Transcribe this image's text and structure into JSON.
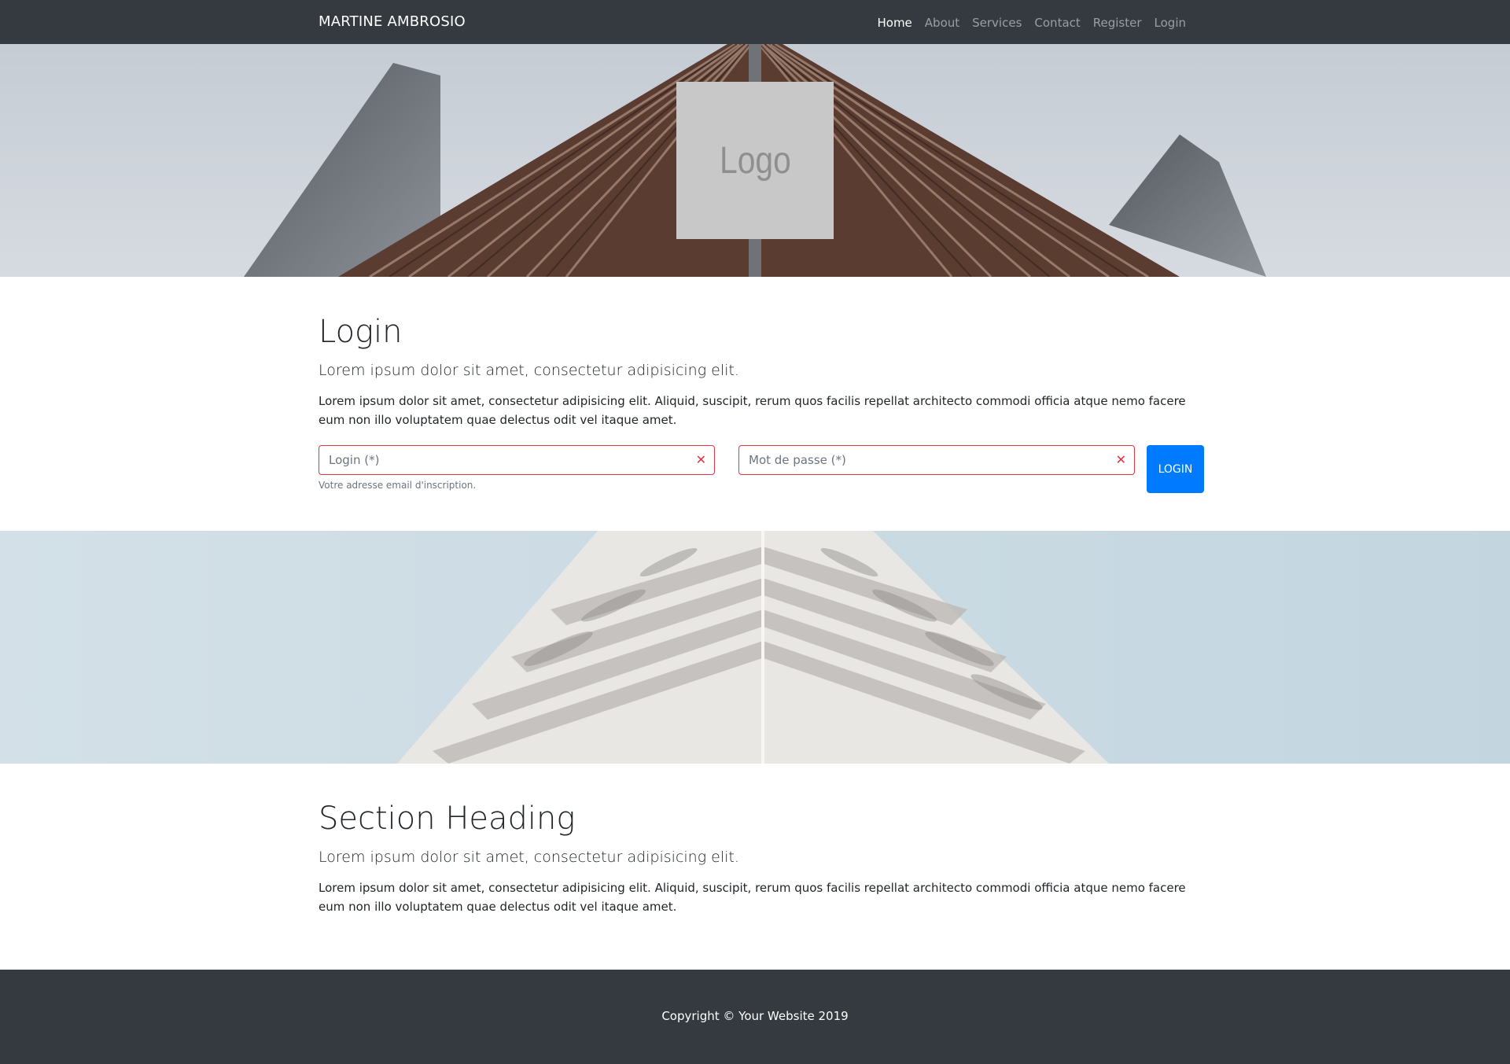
{
  "nav": {
    "brand": "MARTINE AMBROSIO",
    "links": [
      "Home",
      "About",
      "Services",
      "Contact",
      "Register",
      "Login"
    ]
  },
  "hero": {
    "logo_text": "Logo"
  },
  "login_section": {
    "title": "Login",
    "lead": "Lorem ipsum dolor sit amet, consectetur adipisicing elit.",
    "body": "Lorem ipsum dolor sit amet, consectetur adipisicing elit. Aliquid, suscipit, rerum quos facilis repellat architecto commodi officia atque nemo facere eum non illo voluptatem quae delectus odit vel itaque amet."
  },
  "form": {
    "login_placeholder": "Login (*)",
    "login_help": "Votre adresse email d'inscription.",
    "password_placeholder": "Mot de passe (*)",
    "submit_label": "LOGIN",
    "error_icon": "✕"
  },
  "section_two": {
    "title": "Section Heading",
    "lead": "Lorem ipsum dolor sit amet, consectetur adipisicing elit.",
    "body": "Lorem ipsum dolor sit amet, consectetur adipisicing elit. Aliquid, suscipit, rerum quos facilis repellat architecto commodi officia atque nemo facere eum non illo voluptatem quae delectus odit vel itaque amet."
  },
  "footer": {
    "copyright": "Copyright © Your Website 2019"
  },
  "colors": {
    "navbar": "#343a40",
    "primary": "#007bff",
    "danger": "#dc3545",
    "muted": "#6c757d"
  }
}
